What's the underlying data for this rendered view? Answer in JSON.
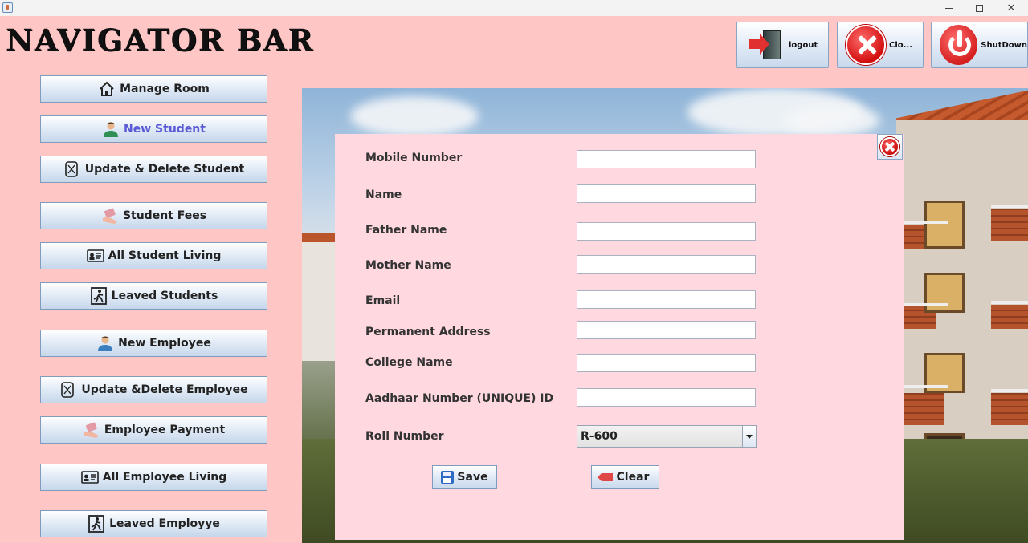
{
  "window": {
    "minimize": "—",
    "maximize": "",
    "close": "✕"
  },
  "app_title": "NAVIGATOR BAR",
  "top_buttons": {
    "logout": "logout",
    "close": "Clo...",
    "shutdown": "ShutDown"
  },
  "sidebar": {
    "items": [
      {
        "label": "Manage Room",
        "icon": "home-icon"
      },
      {
        "label": "New Student",
        "icon": "student-icon"
      },
      {
        "label": "Update & Delete Student",
        "icon": "edit-document-icon"
      },
      {
        "label": "Student Fees",
        "icon": "money-hand-icon"
      },
      {
        "label": "All Student Living",
        "icon": "id-card-icon"
      },
      {
        "label": "Leaved Students",
        "icon": "exit-person-icon"
      },
      {
        "label": "New Employee",
        "icon": "employee-icon"
      },
      {
        "label": "Update &Delete Employee",
        "icon": "edit-document-icon"
      },
      {
        "label": "Employee Payment",
        "icon": "money-hand-icon"
      },
      {
        "label": "All Employee Living",
        "icon": "id-card-icon"
      },
      {
        "label": "Leaved Employye",
        "icon": "exit-person-icon"
      }
    ]
  },
  "form": {
    "fields": [
      {
        "label": "Mobile Number",
        "value": ""
      },
      {
        "label": "Name",
        "value": ""
      },
      {
        "label": "Father Name",
        "value": ""
      },
      {
        "label": "Mother Name",
        "value": ""
      },
      {
        "label": "Email",
        "value": ""
      },
      {
        "label": "Permanent Address",
        "value": ""
      },
      {
        "label": "College Name",
        "value": ""
      },
      {
        "label": "Aadhaar Number (UNIQUE) ID",
        "value": ""
      }
    ],
    "roll_label": "Roll Number",
    "roll_value": "R-600",
    "save_label": "Save",
    "clear_label": "Clear"
  },
  "colors": {
    "background": "#ffc6c6",
    "form_panel": "#ffd8e0",
    "active_nav_text": "#5a5ad6"
  }
}
